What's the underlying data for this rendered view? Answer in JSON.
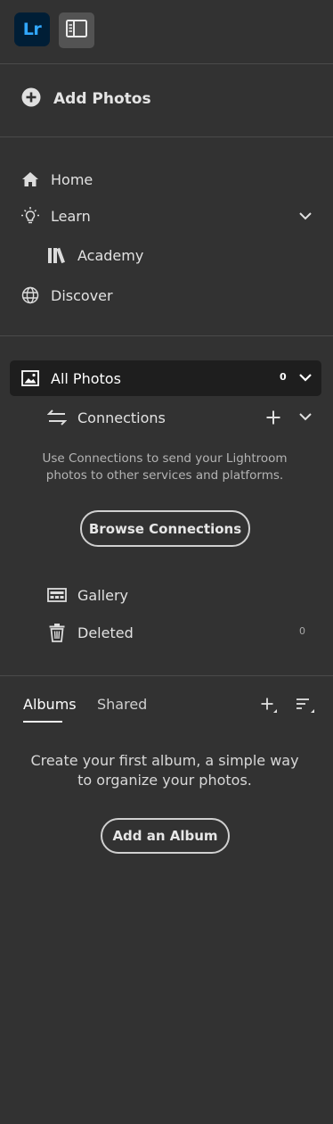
{
  "app": {
    "logo_text": "Lr",
    "brand_color": "#31a8ff",
    "logo_bg": "#001e36"
  },
  "header": {
    "add_photos_label": "Add Photos"
  },
  "nav": {
    "home": "Home",
    "learn": "Learn",
    "academy": "Academy",
    "discover": "Discover"
  },
  "library": {
    "all_photos": {
      "label": "All Photos",
      "count": "0"
    },
    "connections": {
      "label": "Connections",
      "help_text": "Use Connections to send your Lightroom photos to other services and platforms.",
      "browse_button": "Browse Connections"
    },
    "gallery": "Gallery",
    "deleted": {
      "label": "Deleted",
      "count": "0"
    }
  },
  "albums": {
    "tabs": [
      "Albums",
      "Shared"
    ],
    "active_tab": "Albums",
    "empty_text": "Create your first album, a simple way to organize your photos.",
    "add_button": "Add an Album"
  }
}
